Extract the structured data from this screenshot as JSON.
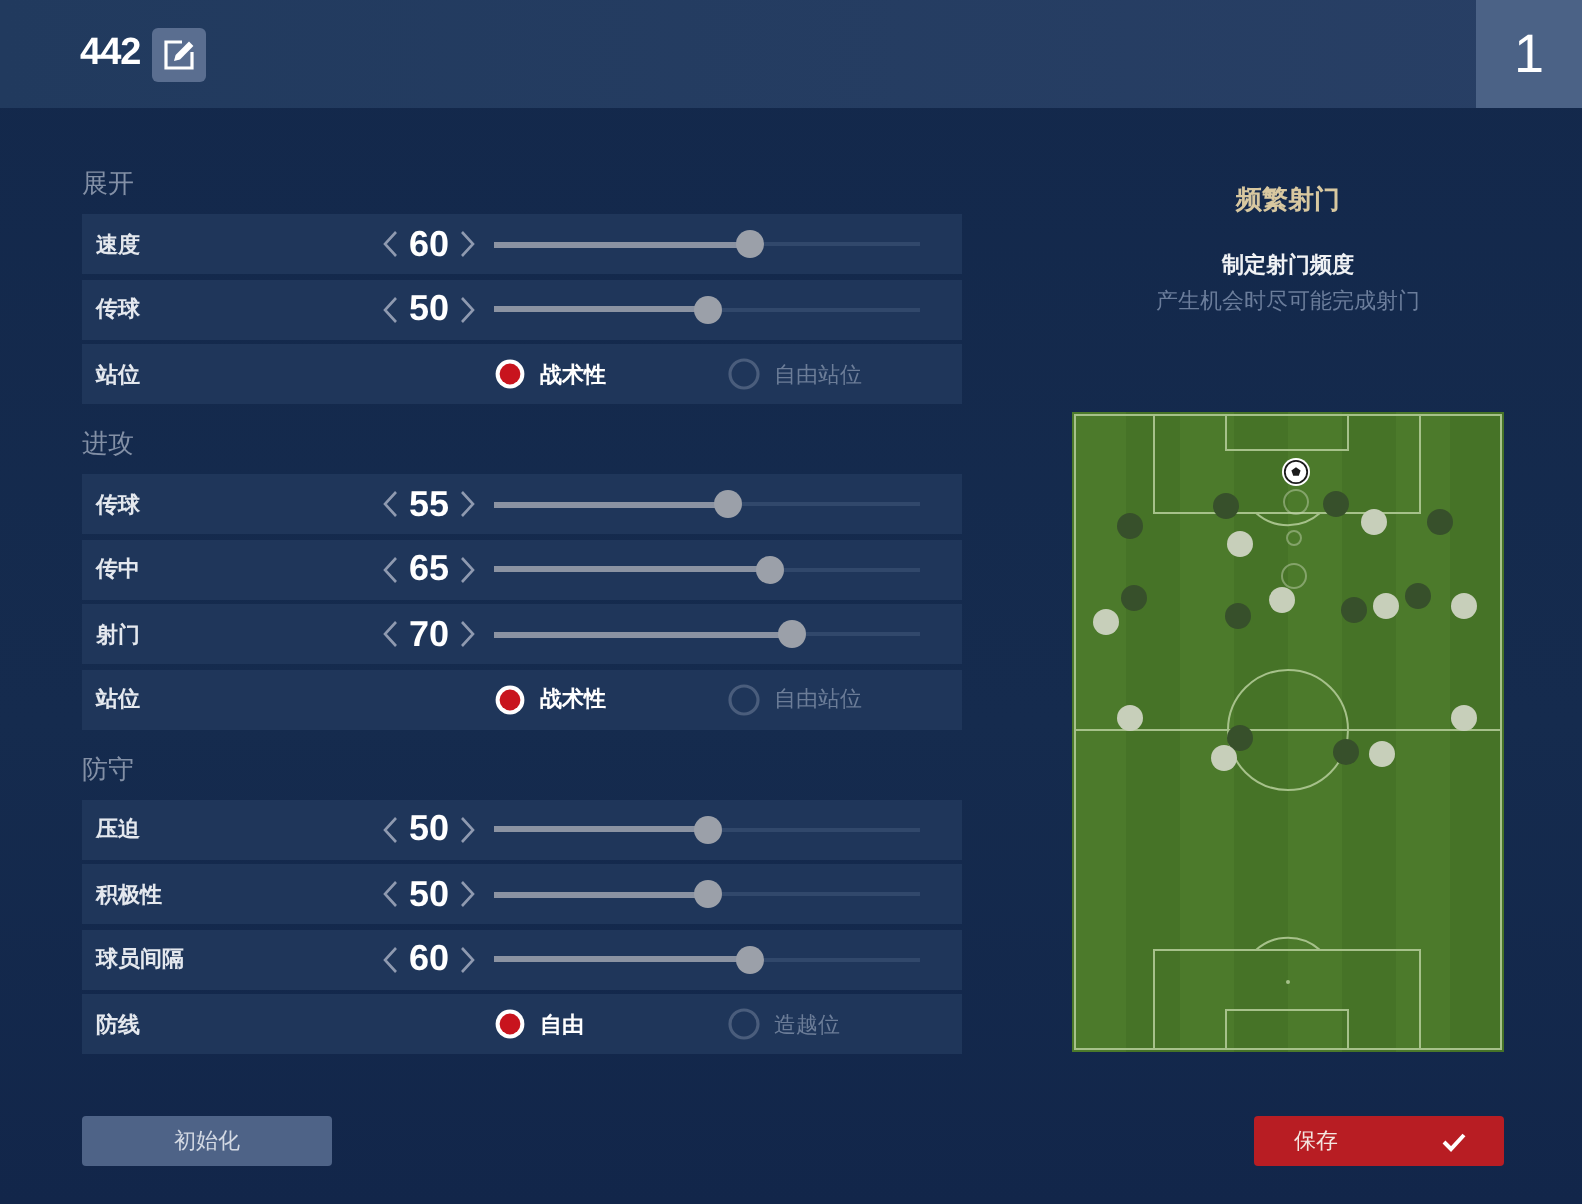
{
  "header": {
    "title": "442",
    "number": "1"
  },
  "sections": [
    {
      "title": "展开",
      "rows": [
        {
          "kind": "slider",
          "label": "速度",
          "value": "60",
          "level": 0.6
        },
        {
          "kind": "slider",
          "label": "传球",
          "value": "50",
          "level": 0.5
        },
        {
          "kind": "radio",
          "label": "站位",
          "options": [
            {
              "label": "战术性",
              "selected": true
            },
            {
              "label": "自由站位",
              "selected": false
            }
          ]
        }
      ]
    },
    {
      "title": "进攻",
      "rows": [
        {
          "kind": "slider",
          "label": "传球",
          "value": "55",
          "level": 0.55
        },
        {
          "kind": "slider",
          "label": "传中",
          "value": "65",
          "level": 0.65
        },
        {
          "kind": "slider",
          "label": "射门",
          "value": "70",
          "level": 0.7
        },
        {
          "kind": "radio",
          "label": "站位",
          "options": [
            {
              "label": "战术性",
              "selected": true
            },
            {
              "label": "自由站位",
              "selected": false
            }
          ]
        }
      ]
    },
    {
      "title": "防守",
      "rows": [
        {
          "kind": "slider",
          "label": "压迫",
          "value": "50",
          "level": 0.5
        },
        {
          "kind": "slider",
          "label": "积极性",
          "value": "50",
          "level": 0.5
        },
        {
          "kind": "slider",
          "label": "球员间隔",
          "value": "60",
          "level": 0.6
        },
        {
          "kind": "radio",
          "label": "防线",
          "options": [
            {
              "label": "自由",
              "selected": true
            },
            {
              "label": "造越位",
              "selected": false
            }
          ]
        }
      ]
    }
  ],
  "tactic_info": {
    "title": "频繁射门",
    "subtitle": "制定射门频度",
    "description": "产生机会时尽可能完成射门"
  },
  "buttons": [
    {
      "kind": "secondary",
      "label": "初始化"
    },
    {
      "kind": "primary",
      "label": "保存"
    }
  ]
}
